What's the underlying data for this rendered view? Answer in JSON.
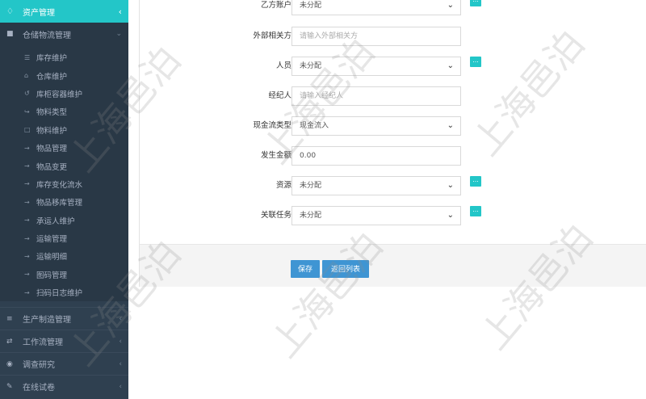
{
  "sidebar": {
    "header": {
      "label": "资产管理",
      "icon": "diamond-icon"
    },
    "group": {
      "label": "仓储物流管理",
      "icon": "truck-icon"
    },
    "items": [
      {
        "label": "库存维护",
        "icon": "list-icon"
      },
      {
        "label": "仓库维护",
        "icon": "home-icon"
      },
      {
        "label": "库柜容器维护",
        "icon": "history-icon"
      },
      {
        "label": "物料类型",
        "icon": "signin-icon"
      },
      {
        "label": "物料维护",
        "icon": "bookmark-icon"
      },
      {
        "label": "物品管理",
        "icon": "login-icon"
      },
      {
        "label": "物品变更",
        "icon": "login-icon"
      },
      {
        "label": "库存变化流水",
        "icon": "login-icon"
      },
      {
        "label": "物品移库管理",
        "icon": "login-icon"
      },
      {
        "label": "承运人维护",
        "icon": "login-icon"
      },
      {
        "label": "运输管理",
        "icon": "login-icon"
      },
      {
        "label": "运输明细",
        "icon": "login-icon"
      },
      {
        "label": "图码管理",
        "icon": "login-icon"
      },
      {
        "label": "扫码日志维护",
        "icon": "login-icon"
      }
    ],
    "bottom_groups": [
      {
        "label": "生产制造管理",
        "icon": "sliders-icon"
      },
      {
        "label": "工作流管理",
        "icon": "random-icon"
      },
      {
        "label": "调查研究",
        "icon": "globe-icon"
      },
      {
        "label": "在线试卷",
        "icon": "edit-icon"
      }
    ]
  },
  "form": {
    "party_b_account": {
      "label": "乙方账户",
      "value": "未分配"
    },
    "external_party": {
      "label": "外部相关方",
      "placeholder": "请输入外部相关方"
    },
    "person": {
      "label": "人员",
      "value": "未分配"
    },
    "agent": {
      "label": "经纪人",
      "placeholder": "请输入经纪人"
    },
    "cashflow_type": {
      "label": "现金流类型",
      "value": "现金流入"
    },
    "amount": {
      "label": "发生金额",
      "value": "0.00"
    },
    "resource": {
      "label": "资源",
      "value": "未分配"
    },
    "related_task": {
      "label": "关联任务",
      "value": "未分配"
    },
    "picker_glyph": "...",
    "caret_glyph": "⌄"
  },
  "actions": {
    "save": "保存",
    "back": "返回列表"
  },
  "watermark": "上海邑泊",
  "colors": {
    "sidebar": "#2f4050",
    "accent": "#23c6c8",
    "button": "#3f95d3"
  }
}
